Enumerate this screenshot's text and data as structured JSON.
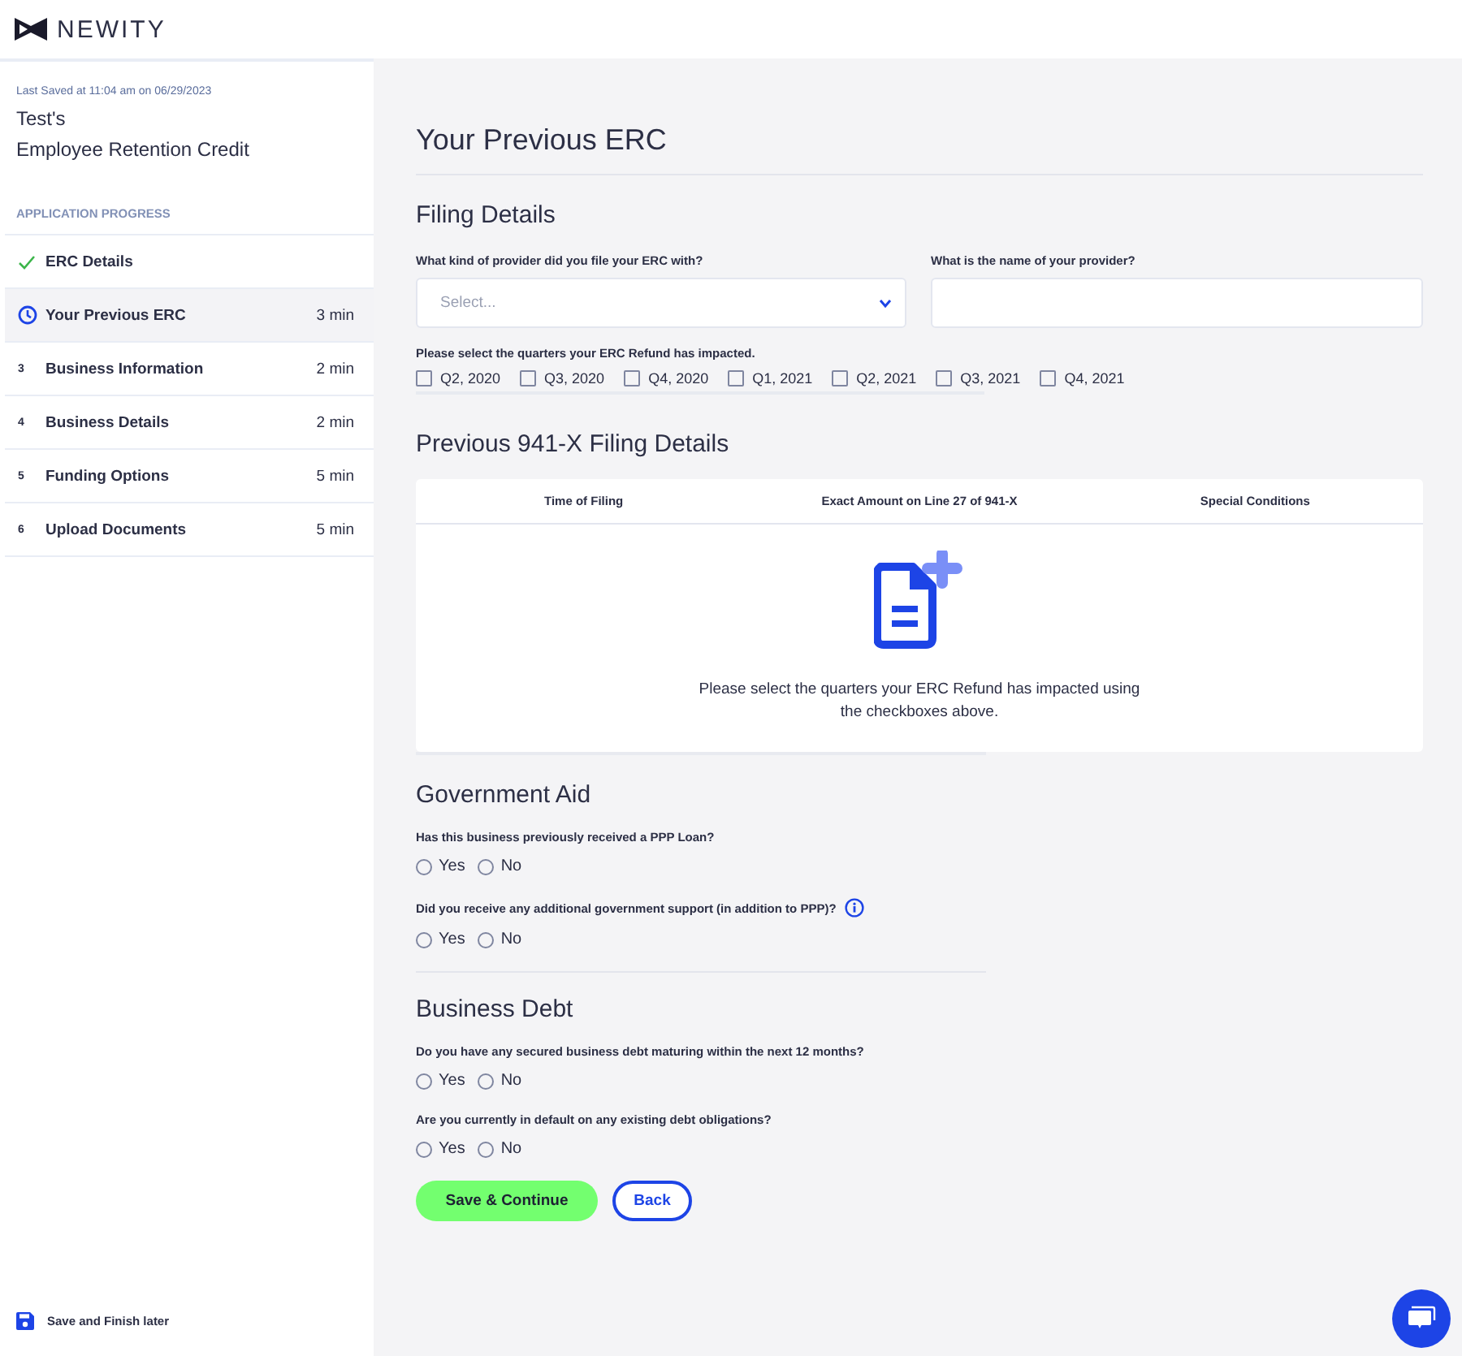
{
  "header": {
    "logo_text": "NEWITY"
  },
  "sidebar": {
    "last_saved": "Last Saved at 11:04 am on 06/29/2023",
    "owner": "Test's",
    "program": "Employee Retention Credit",
    "progress_heading": "APPLICATION PROGRESS",
    "steps": [
      {
        "kind": "done",
        "label": "ERC Details",
        "selected": false
      },
      {
        "kind": "current",
        "label": "Your Previous ERC",
        "time": "3 min",
        "selected": true
      },
      {
        "kind": "numbered",
        "number": "3",
        "label": "Business Information",
        "time": "2 min",
        "selected": false
      },
      {
        "kind": "numbered",
        "number": "4",
        "label": "Business Details",
        "time": "2 min",
        "selected": false
      },
      {
        "kind": "numbered",
        "number": "5",
        "label": "Funding Options",
        "time": "5 min",
        "selected": false
      },
      {
        "kind": "numbered",
        "number": "6",
        "label": "Upload Documents",
        "time": "5 min",
        "selected": false
      }
    ],
    "save_later": "Save and Finish later"
  },
  "page_title": "Your Previous ERC",
  "filing_details": {
    "title": "Filing Details",
    "provider_kind": {
      "label": "What kind of provider did you file your ERC with?",
      "placeholder": "Select..."
    },
    "provider_name": {
      "label": "What is the name of your provider?"
    },
    "quarters_label": "Please select the quarters your ERC Refund has impacted.",
    "quarters": [
      {
        "label": "Q2, 2020",
        "checked": false
      },
      {
        "label": "Q3, 2020",
        "checked": false
      },
      {
        "label": "Q4, 2020",
        "checked": false
      },
      {
        "label": "Q1, 2021",
        "checked": false
      },
      {
        "label": "Q2, 2021",
        "checked": false
      },
      {
        "label": "Q3, 2021",
        "checked": false
      },
      {
        "label": "Q4, 2021",
        "checked": false
      }
    ]
  },
  "previous_filings": {
    "title": "Previous 941-X Filing Details",
    "table": {
      "columns": [
        "Time of Filing",
        "Exact Amount on Line 27 of 941-X",
        "Special Conditions"
      ],
      "empty_message": "Please select the quarters your ERC Refund has impacted using the checkboxes above."
    }
  },
  "sections": [
    {
      "title": "Government Aid",
      "questions": [
        {
          "text": "Has this business previously received a PPP Loan?",
          "info": false,
          "options": [
            {
              "label": "Yes",
              "selected": false
            },
            {
              "label": "No",
              "selected": false
            }
          ]
        },
        {
          "text": "Did you receive any additional government support (in addition to PPP)?",
          "info": true,
          "options": [
            {
              "label": "Yes",
              "selected": false
            },
            {
              "label": "No",
              "selected": false
            }
          ]
        }
      ]
    },
    {
      "title": "Business Debt",
      "questions": [
        {
          "text": "Do you have any secured business debt maturing within the next 12 months?",
          "info": false,
          "options": [
            {
              "label": "Yes",
              "selected": false
            },
            {
              "label": "No",
              "selected": false
            }
          ]
        },
        {
          "text": "Are you currently in default on any existing debt obligations?",
          "info": false,
          "options": [
            {
              "label": "Yes",
              "selected": false
            },
            {
              "label": "No",
              "selected": false
            }
          ]
        }
      ]
    }
  ],
  "actions": {
    "primary": "Save & Continue",
    "secondary": "Back"
  }
}
